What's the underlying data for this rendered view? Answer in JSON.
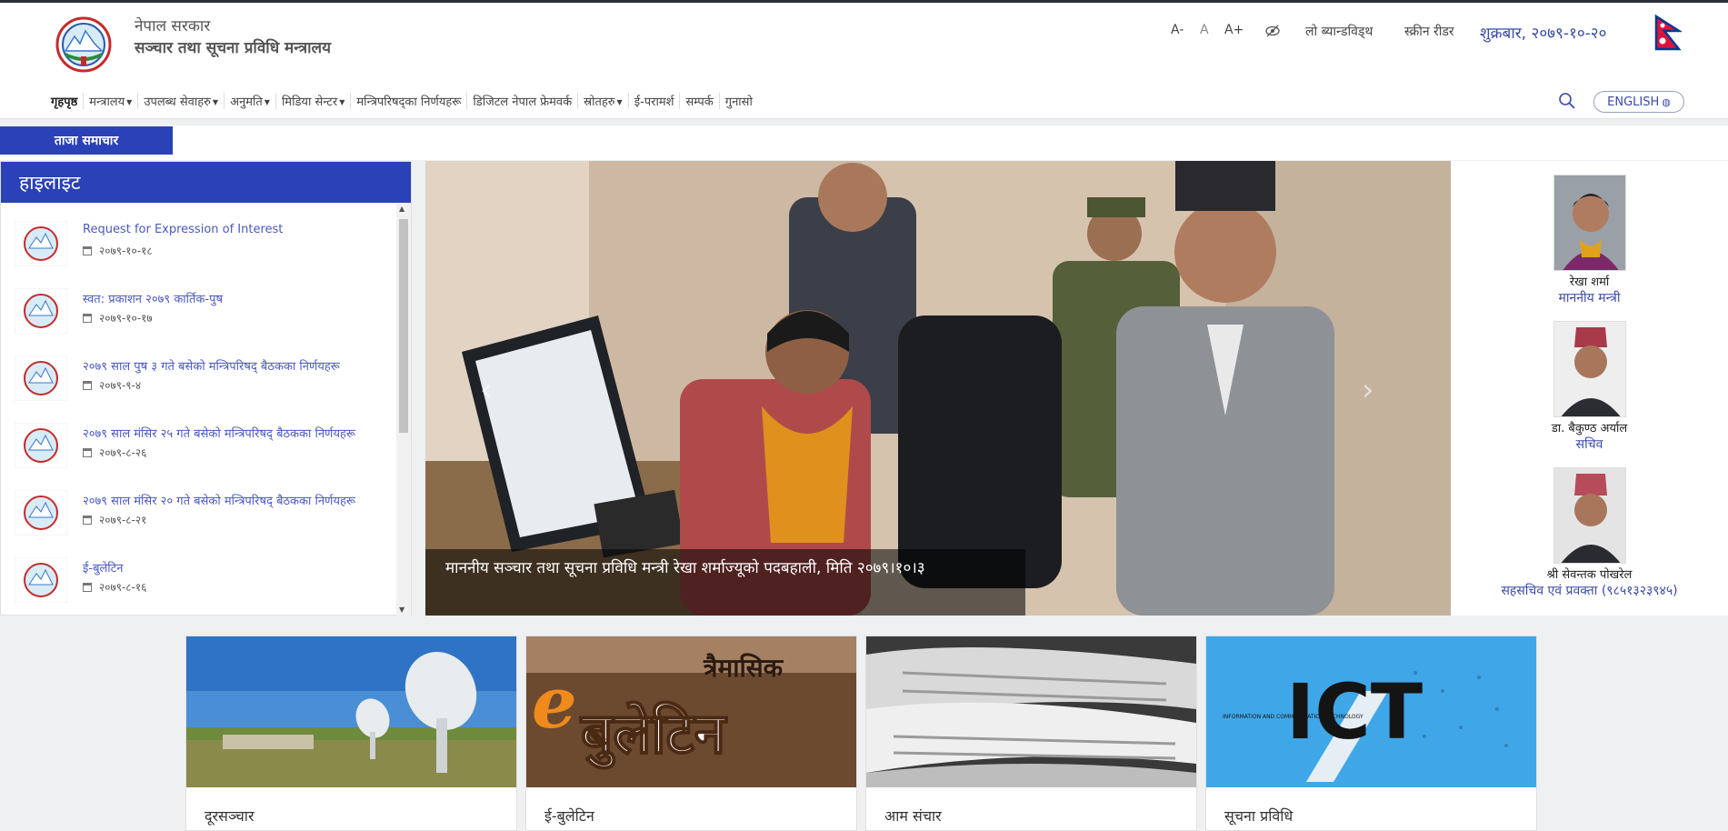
{
  "header": {
    "gov_name": "नेपाल सरकार",
    "ministry_name": "सञ्चार तथा सूचना प्रविधि मन्त्रालय",
    "font_decrease": "A-",
    "font_normal": "A",
    "font_increase": "A+",
    "low_bandwidth": "लो ब्यान्डविड्थ",
    "screen_reader": "स्क्रीन रीडर",
    "date": "शुक्रबार, २०७९-१०-२०"
  },
  "nav": {
    "items": [
      {
        "label": "गृहपृष्ठ",
        "dropdown": false
      },
      {
        "label": "मन्त्रालय",
        "dropdown": true
      },
      {
        "label": "उपलब्ध सेवाहरु",
        "dropdown": true
      },
      {
        "label": "अनुमति",
        "dropdown": true
      },
      {
        "label": "मिडिया सेन्टर",
        "dropdown": true
      },
      {
        "label": "मन्त्रिपरिषद्का निर्णयहरू",
        "dropdown": false
      },
      {
        "label": "डिजिटल नेपाल फ्रेमवर्क",
        "dropdown": false
      },
      {
        "label": "स्रोतहरु",
        "dropdown": true
      },
      {
        "label": "ई-परामर्श",
        "dropdown": false
      },
      {
        "label": "सम्पर्क",
        "dropdown": false
      },
      {
        "label": "गुनासो",
        "dropdown": false
      }
    ],
    "language_button": "ENGLISH"
  },
  "latest_news_label": "ताजा समाचार",
  "highlight": {
    "heading": "हाइलाइट",
    "items": [
      {
        "title": "Request for Expression of Interest",
        "date": "२०७९-१०-१८"
      },
      {
        "title": "स्वत: प्रकाशन २०७९ कार्तिक-पुष",
        "date": "२०७९-१०-१७"
      },
      {
        "title": "२०७९ साल पुष ३ गते बसेको मन्त्रिपरिषद् बैठकका निर्णयहरू",
        "date": "२०७९-९-४"
      },
      {
        "title": "२०७९ साल मंसिर २५ गते बसेको मन्त्रिपरिषद् बैठकका निर्णयहरू",
        "date": "२०७९-८-२६"
      },
      {
        "title": "२०७९ साल मंसिर २० गते बसेको मन्त्रिपरिषद् बैठकका निर्णयहरू",
        "date": "२०७९-८-२१"
      },
      {
        "title": "ई-बुलेटिन",
        "date": "२०७९-८-१६"
      }
    ]
  },
  "slider": {
    "caption": "माननीय सञ्चार तथा सूचना प्रविधि मन्त्री रेखा शर्माज्यूको पदबहाली, मिति २०७९।१०।३"
  },
  "officials": [
    {
      "name": "रेखा शर्मा",
      "role": "माननीय मन्त्री"
    },
    {
      "name": "डा. बैकुण्ठ अर्याल",
      "role": "सचिव"
    },
    {
      "name": "श्री सेवन्तक पोखरेल",
      "role": "सहसचिव एवं प्रवक्ता (९८५१३२३९४५)"
    }
  ],
  "cards": [
    {
      "title": "दूरसञ्चार"
    },
    {
      "title": "ई-बुलेटिन",
      "image_text_top": "त्रैमासिक",
      "image_text_letter": "e",
      "image_text_main": "बुलेटिन"
    },
    {
      "title": "आम संचार"
    },
    {
      "title": "सूचना प्रविधि",
      "image_text_main": "ICT",
      "image_text_small": "INFORMATION AND COMMUNICATION TECHNOLOGY"
    }
  ],
  "colors": {
    "primary_blue": "#2a41b8",
    "link_blue": "#4b58c0",
    "date_blue": "#3a4aa8"
  }
}
